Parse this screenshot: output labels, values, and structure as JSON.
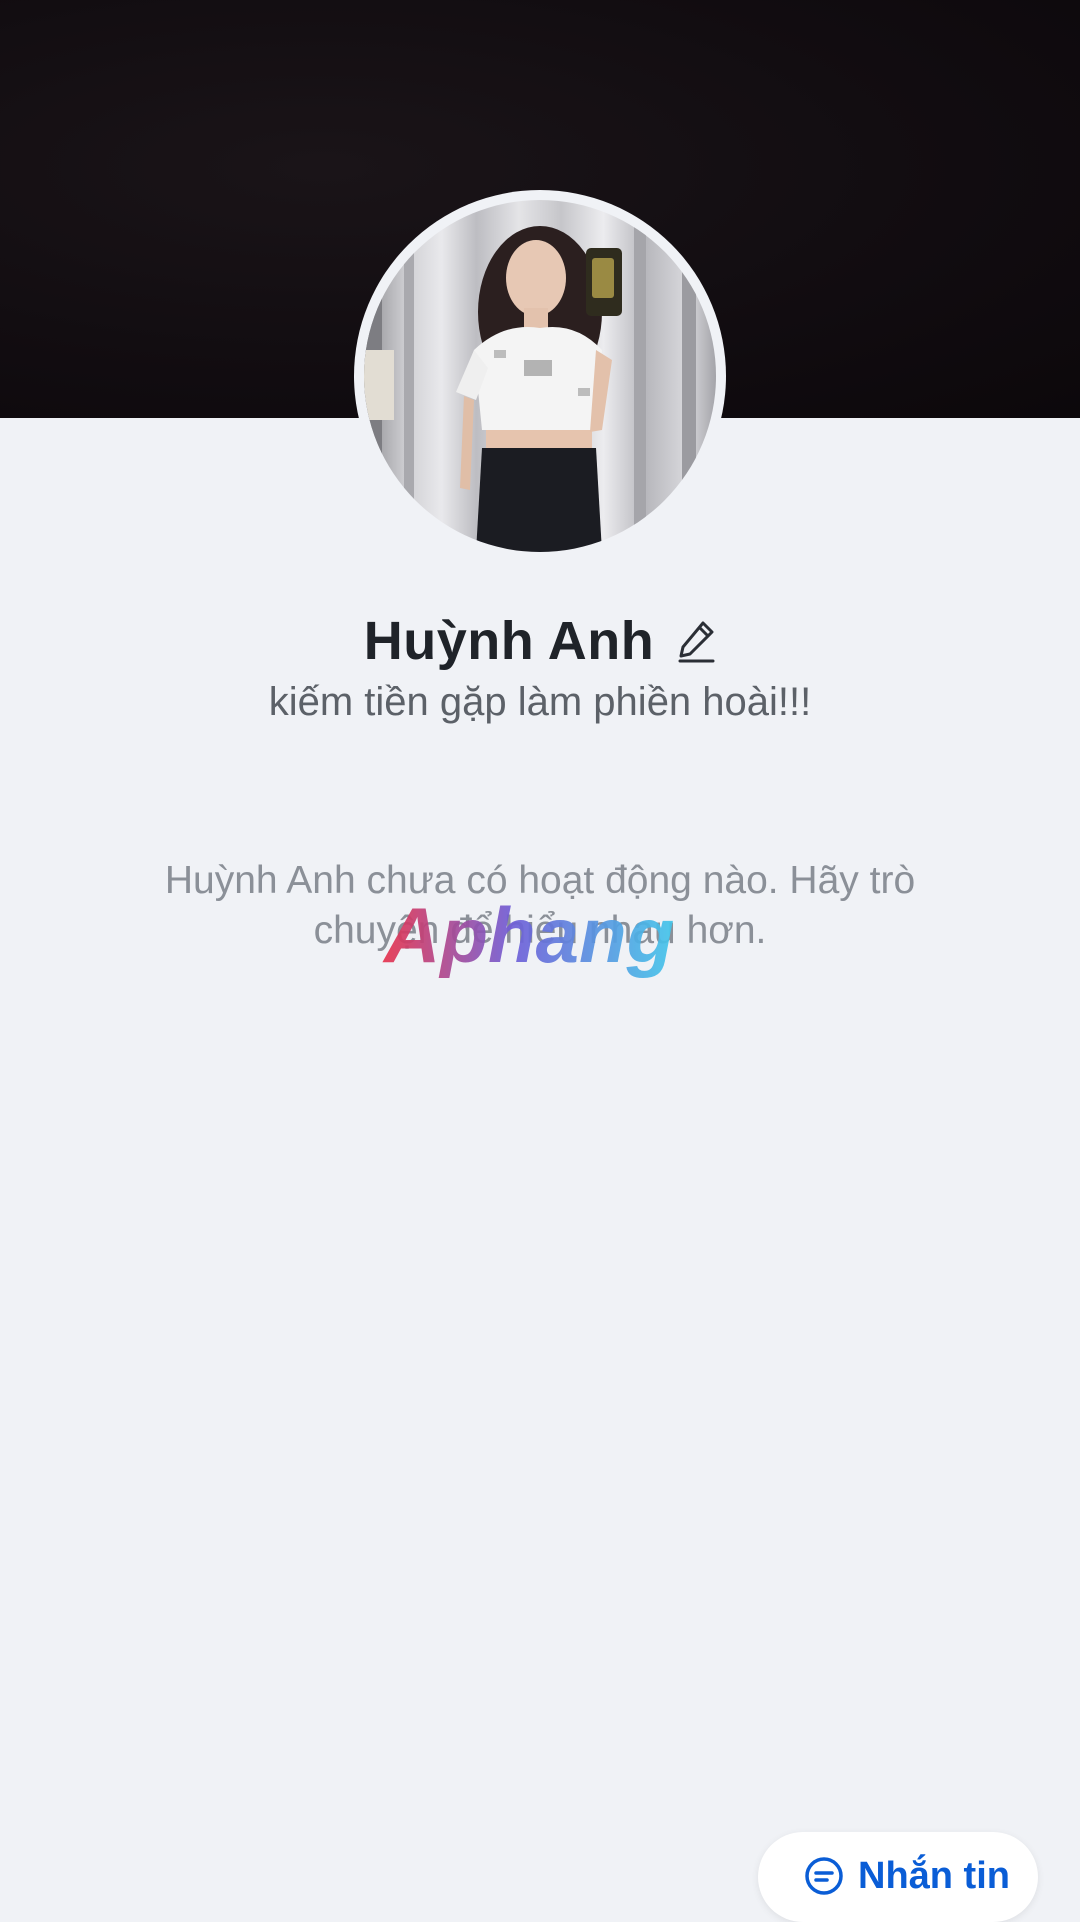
{
  "profile": {
    "name": "Huỳnh Anh",
    "status": "kiếm tiền gặp làm phiền hoài!!!",
    "cover_color": "#110c10"
  },
  "feed": {
    "empty_message": "Huỳnh Anh chưa có hoạt động nào. Hãy trò chuyện để hiểu nhau hơn."
  },
  "watermark": {
    "text": "Aphang"
  },
  "actions": {
    "message_label": "Nhắn tin",
    "accent_color": "#0a5dd6"
  },
  "icons": {
    "edit": "pencil-icon",
    "message": "chat-bubble-icon"
  }
}
